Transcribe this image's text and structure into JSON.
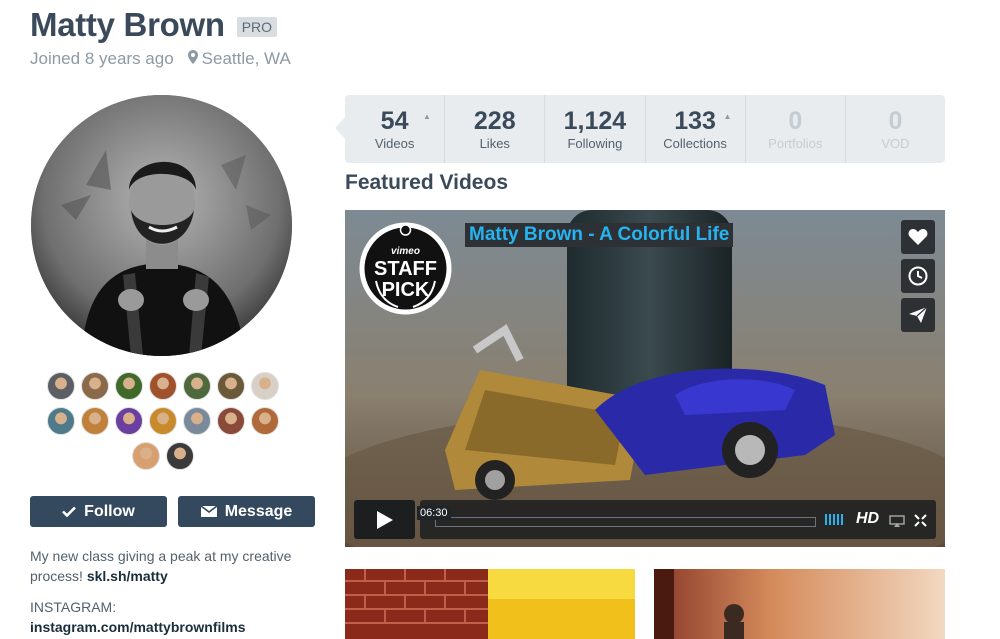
{
  "profile": {
    "name": "Matty Brown",
    "badge": "PRO",
    "joined": "Joined 8 years ago",
    "location": "Seattle, WA"
  },
  "actions": {
    "follow": "Follow",
    "message": "Message"
  },
  "bio": {
    "text": "My new class giving a peak at my creative process!",
    "link": "skl.sh/matty",
    "instagram_label": "INSTAGRAM:",
    "instagram_link": "instagram.com/mattybrownfilms"
  },
  "stats": [
    {
      "value": "54",
      "label": "Videos"
    },
    {
      "value": "228",
      "label": "Likes"
    },
    {
      "value": "1,124",
      "label": "Following"
    },
    {
      "value": "133",
      "label": "Collections"
    },
    {
      "value": "0",
      "label": "Portfolios"
    },
    {
      "value": "0",
      "label": "VOD"
    }
  ],
  "featured": {
    "heading": "Featured Videos",
    "video_title": "Matty Brown - A Colorful Life",
    "timecode": "06:30",
    "quality": "HD",
    "staff_pick_line1": "vimeo",
    "staff_pick_line2": "STAFF",
    "staff_pick_line3": "PICK"
  },
  "followers": [
    {
      "color": "#5b5f63"
    },
    {
      "color": "#8a6a4a"
    },
    {
      "color": "#3f6a2a"
    },
    {
      "color": "#a0522d"
    },
    {
      "color": "#4e6a3c"
    },
    {
      "color": "#6a5a3a"
    },
    {
      "color": "#d8d0c6"
    },
    {
      "color": "#4f7a8a"
    },
    {
      "color": "#c0823a"
    },
    {
      "color": "#6a3fa0"
    },
    {
      "color": "#c88a2a"
    },
    {
      "color": "#7a8a9a"
    },
    {
      "color": "#8a4a3a"
    },
    {
      "color": "#b06a3a"
    },
    {
      "color": "#d8a070"
    },
    {
      "color": "#3a3a3a"
    }
  ],
  "colors": {
    "accent": "#34495e",
    "link_blue": "#26b3f0",
    "stats_bg": "#e9ecef"
  }
}
